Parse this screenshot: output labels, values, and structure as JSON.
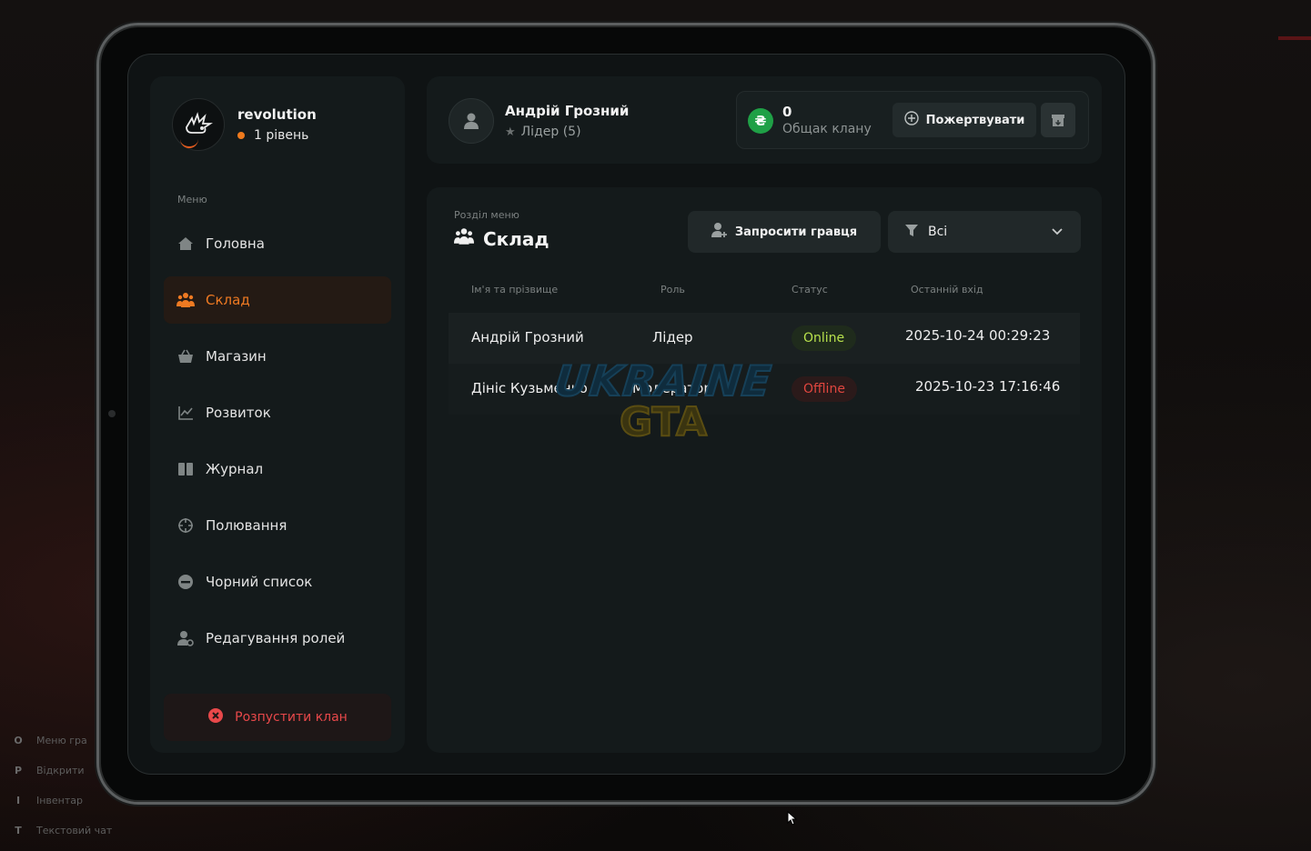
{
  "background_hints": [
    {
      "key": "O",
      "label": "Меню гра"
    },
    {
      "key": "P",
      "label": "Відкрити"
    },
    {
      "key": "I",
      "label": "Інвентар"
    },
    {
      "key": "T",
      "label": "Текстовий чат"
    }
  ],
  "clan": {
    "name": "revolution",
    "level": "1 рівень"
  },
  "sidebar": {
    "caption": "Меню",
    "items": [
      {
        "label": "Головна",
        "icon": "home-icon"
      },
      {
        "label": "Склад",
        "icon": "users-icon",
        "active": true
      },
      {
        "label": "Магазин",
        "icon": "basket-icon"
      },
      {
        "label": "Розвиток",
        "icon": "chart-icon"
      },
      {
        "label": "Журнал",
        "icon": "book-icon"
      },
      {
        "label": "Полювання",
        "icon": "crosshair-icon"
      },
      {
        "label": "Чорний список",
        "icon": "block-icon"
      },
      {
        "label": "Редагування ролей",
        "icon": "user-gear-icon"
      }
    ],
    "disband_label": "Розпустити клан"
  },
  "player": {
    "name": "Андрій Грозний",
    "role": "Лідер (5)"
  },
  "bank": {
    "currency_symbol": "₴",
    "value": "0",
    "caption": "Общак клану",
    "donate_label": "Пожертвувати"
  },
  "section": {
    "caption": "Розділ меню",
    "title": "Склад",
    "invite_label": "Запросити гравця",
    "filter_value": "Всі"
  },
  "table": {
    "headers": [
      "Ім'я та прізвище",
      "Роль",
      "Статус",
      "Останній вхід"
    ],
    "rows": [
      {
        "name": "Андрій Грозний",
        "role": "Лідер",
        "status": "Online",
        "last_login": "2025-10-24 00:29:23"
      },
      {
        "name": "Дініс Кузьменко",
        "role": "Модератор",
        "status": "Offline",
        "last_login": "2025-10-23 17:16:46"
      }
    ]
  },
  "watermark": {
    "line1": "UKRAINE",
    "line2": "GTA"
  },
  "colors": {
    "accent": "#ef7a22",
    "online": "#b8e14c",
    "offline": "#e0463f",
    "coin": "#1fa046",
    "danger": "#e8484a"
  }
}
